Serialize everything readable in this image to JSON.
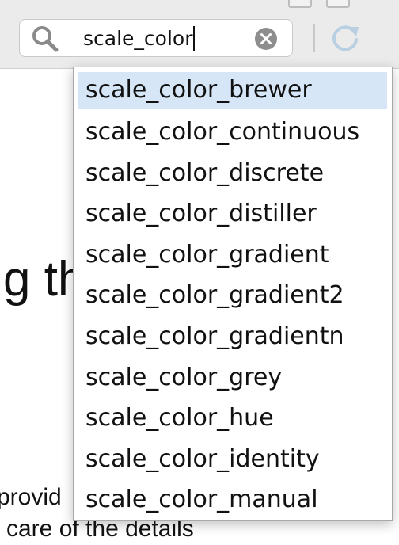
{
  "search": {
    "value": "scale_color"
  },
  "document": {
    "heading_fragment": "g th",
    "line1_fragment": "provid",
    "line2_fragment": "care of the details"
  },
  "autocomplete": {
    "selected_index": 0,
    "items": [
      "scale_color_brewer",
      "scale_color_continuous",
      "scale_color_discrete",
      "scale_color_distiller",
      "scale_color_gradient",
      "scale_color_gradient2",
      "scale_color_gradientn",
      "scale_color_grey",
      "scale_color_hue",
      "scale_color_identity",
      "scale_color_manual"
    ]
  },
  "icons": {
    "search": "search-icon",
    "clear": "clear-icon",
    "refresh": "refresh-icon"
  },
  "colors": {
    "selection": "#d6e6f7",
    "toolbar": "#ebebeb"
  }
}
